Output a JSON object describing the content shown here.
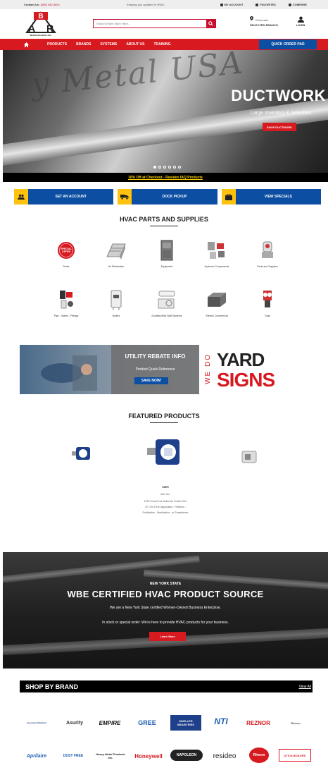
{
  "topbar": {
    "contact_label": "Contact Us",
    "contact_phone": "(585) 482-3601",
    "tagline": "Keeping you updated in HVAC",
    "links": [
      "MY ACCOUNT",
      "FAVORITES",
      "COMPARE"
    ]
  },
  "header": {
    "logo_letters": "ABR",
    "logo_sub": "WHOLESALERS, INC.",
    "search_placeholder": "Search Entire Store Here...",
    "branch_location": "Rochester",
    "branch_label": "SELECTED BRANCH",
    "login_label": "LOGIN"
  },
  "nav": {
    "items": [
      "PRODUCTS",
      "BRANDS",
      "SYSTEMS",
      "ABOUT US",
      "TRAINING"
    ],
    "quick_order": "QUICK ORDER PAD"
  },
  "hero": {
    "headline": "DUCTWORK",
    "subline": "Large Inventory & Selection",
    "cta": "SHOP DUCTWORK",
    "background_text": "y Metal USA",
    "slide_count": 6,
    "active_slide": 1
  },
  "promo": {
    "text": "10% Off at Checkout - Resideo IAQ Products"
  },
  "actions": [
    {
      "label": "SET AN ACCOUNT",
      "icon": "people-icon"
    },
    {
      "label": "DOCK PICKUP",
      "icon": "truck-icon"
    },
    {
      "label": "VIEW SPECIALS",
      "icon": "specials-icon"
    }
  ],
  "categories": {
    "title": "HVAC PARTS AND SUPPLIES",
    "items": [
      {
        "label": "Deals",
        "badge": "SPECIAL OFFER"
      },
      {
        "label": "Air Distribution"
      },
      {
        "label": "Equipment"
      },
      {
        "label": "Hydronic Components"
      },
      {
        "label": "Parts and Supplies"
      },
      {
        "label": "Pipe - Valves - Fittings"
      },
      {
        "label": "Boilers"
      },
      {
        "label": "Ductless/Mini Split Systems"
      },
      {
        "label": "Electric Commercial"
      },
      {
        "label": "Tools"
      }
    ]
  },
  "rebate": {
    "title": "UTILITY REBATE INFO",
    "subtitle": "Product Quick Reference",
    "button": "SAVE NOW!"
  },
  "yard": {
    "we_do": "WE DO",
    "yard": "YARD",
    "signs": "SIGNS"
  },
  "featured": {
    "title": "FEATURED PRODUCTS",
    "name": "SEER",
    "sku": "Item No.",
    "desc_lines": [
      "12371 Dust Free Active Air Purifier 24V",
      "12\" 3 to 5 Ton Application - Filtration -",
      "Purification - Sterilization - w/ Transformer"
    ]
  },
  "wbe": {
    "kicker": "NEW YORK STATE",
    "headline": "WBE CERTIFIED HVAC PRODUCT SOURCE",
    "line1": "We are a New York State certified Women-Owned Business Enterprise.",
    "line2": "In stock or special order: We're here to provide HVAC products for your business.",
    "button": "Learn More"
  },
  "brands": {
    "title": "SHOP BY BRAND",
    "view_all": "View All",
    "row1": [
      "American Standard",
      "Asurity",
      "EMPIRE",
      "GREE",
      "MUELLER INDUSTRIES",
      "NTI",
      "REZNOR",
      "Rheem"
    ],
    "row2": [
      "Aprilaire",
      "DUST FREE",
      "Heavy Metal Products Inc.",
      "Honeywell",
      "NAPOLEON",
      "resideo",
      "Rheem",
      "UTICA BOILERS"
    ]
  },
  "colors": {
    "red": "#d71920",
    "blue": "#0b4ea2",
    "yellow": "#ffc20e",
    "promo_text": "#ffd200"
  }
}
